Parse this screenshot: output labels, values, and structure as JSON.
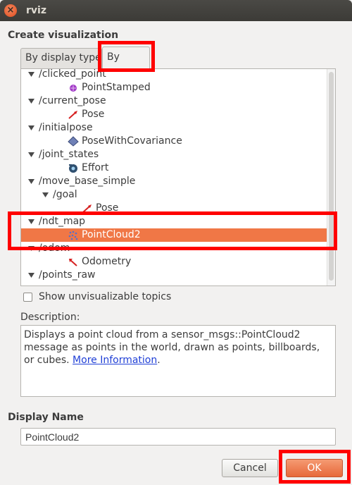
{
  "window": {
    "title": "rviz",
    "close_glyph": "×"
  },
  "header": {
    "label": "Create visualization"
  },
  "tabs": [
    {
      "label": "By display type",
      "active": false
    },
    {
      "label": "By topic",
      "active": true
    }
  ],
  "tree": [
    {
      "label": "/clicked_point",
      "level": 0,
      "expandable": true
    },
    {
      "label": "PointStamped",
      "level": 1,
      "icon": "point-stamped-icon"
    },
    {
      "label": "/current_pose",
      "level": 0,
      "expandable": true
    },
    {
      "label": "Pose",
      "level": 1,
      "icon": "pose-arrow-icon"
    },
    {
      "label": "/initialpose",
      "level": 0,
      "expandable": true
    },
    {
      "label": "PoseWithCovariance",
      "level": 1,
      "icon": "pose-covariance-icon"
    },
    {
      "label": "/joint_states",
      "level": 0,
      "expandable": true
    },
    {
      "label": "Effort",
      "level": 1,
      "icon": "effort-icon"
    },
    {
      "label": "/move_base_simple",
      "level": 0,
      "expandable": true
    },
    {
      "label": "/goal",
      "level": 1,
      "expandable": true
    },
    {
      "label": "Pose",
      "level": 2,
      "icon": "pose-arrow-icon"
    },
    {
      "label": "/ndt_map",
      "level": 0,
      "expandable": true
    },
    {
      "label": "PointCloud2",
      "level": 1,
      "icon": "pointcloud-icon",
      "selected": true
    },
    {
      "label": "/odom",
      "level": 0,
      "expandable": true
    },
    {
      "label": "Odometry",
      "level": 1,
      "icon": "odometry-icon"
    },
    {
      "label": "/points_raw",
      "level": 0,
      "expandable": true
    }
  ],
  "show_unvisualizable": {
    "label": "Show unvisualizable topics",
    "checked": false
  },
  "description": {
    "label": "Description:",
    "text": "Displays a point cloud from a sensor_msgs::PointCloud2 message as points in the world, drawn as points, billboards, or cubes. ",
    "link": "More Information",
    "trailing": "."
  },
  "display_name": {
    "label": "Display Name",
    "value": "PointCloud2"
  },
  "buttons": {
    "cancel": "Cancel",
    "ok": "OK"
  },
  "colors": {
    "accent": "#f07746",
    "highlight": "#ff0000",
    "link": "#1f3fd6"
  }
}
